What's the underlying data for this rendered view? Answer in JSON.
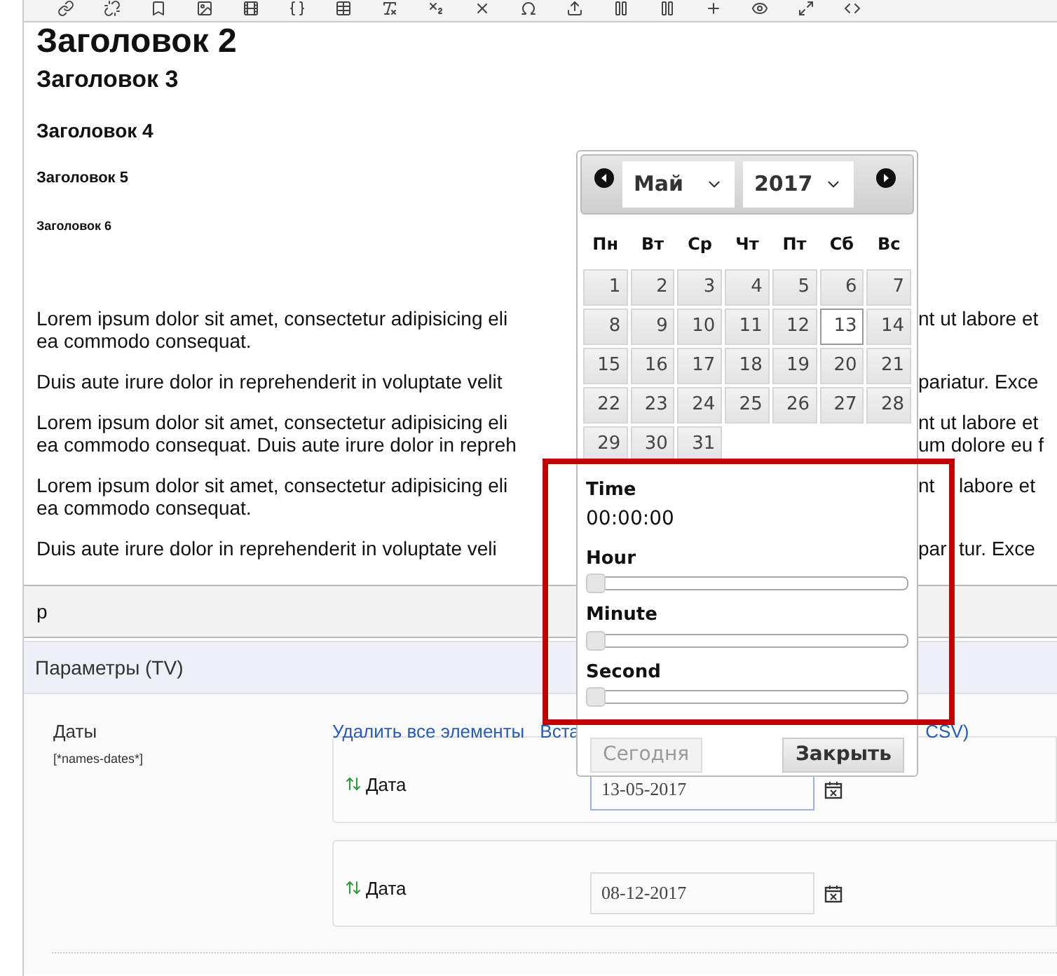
{
  "headings": [
    {
      "kind": "h2",
      "text": "Заголовок 2"
    },
    {
      "kind": "h3",
      "text": "Заголовок 3"
    },
    {
      "kind": "h4",
      "text": "Заголовок 4"
    },
    {
      "kind": "h5",
      "text": "Заголовок 5"
    },
    {
      "kind": "h6",
      "text": "Заголовок 6"
    }
  ],
  "paragraphs": [
    {
      "lines": [
        {
          "left": "Lorem ipsum dolor sit amet, consectetur adipisicing eli",
          "right": [
            "nt ut labore et"
          ]
        },
        {
          "left": "ea commodo consequat."
        }
      ]
    },
    {
      "lines": [
        {
          "left": "Duis aute irure dolor in reprehenderit in voluptate velit",
          "right": [
            "pariatur. Exce"
          ]
        }
      ]
    },
    {
      "lines": [
        {
          "left": "Lorem ipsum dolor sit amet, consectetur adipisicing eli",
          "right": [
            "nt ut labore et"
          ]
        },
        {
          "left": "ea commodo consequat. Duis aute irure dolor in repreh",
          "right": [
            "um dolore eu f"
          ]
        }
      ]
    },
    {
      "lines": [
        {
          "left": "Lorem ipsum dolor sit amet, consectetur adipisicing eli",
          "right": [
            "nt",
            "labore et"
          ]
        },
        {
          "left": "ea commodo consequat."
        }
      ]
    },
    {
      "lines": [
        {
          "left": "Duis aute irure dolor in reprehenderit in voluptate veli",
          "right": [
            "par",
            "tur. Exce"
          ]
        }
      ]
    }
  ],
  "element_path": "p",
  "panel": {
    "title": "Параметры (TV)",
    "field_label": "Даты",
    "field_tag": "[*names-dates*]",
    "links": [
      "Удалить все элементы",
      "Вста",
      "CSV)"
    ],
    "items": [
      {
        "label": "Дата",
        "value": "13-05-2017",
        "focused": true
      },
      {
        "label": "Дата",
        "value": "08-12-2017",
        "focused": false
      }
    ]
  },
  "datepicker": {
    "month": "Май",
    "year": "2017",
    "weekdays": [
      "Пн",
      "Вт",
      "Ср",
      "Чт",
      "Пт",
      "Сб",
      "Вс"
    ],
    "days": [
      {
        "day": "1",
        "selected": false
      },
      {
        "day": "2",
        "selected": false
      },
      {
        "day": "3",
        "selected": false
      },
      {
        "day": "4",
        "selected": false
      },
      {
        "day": "5",
        "selected": false
      },
      {
        "day": "6",
        "selected": false
      },
      {
        "day": "7",
        "selected": false
      },
      {
        "day": "8",
        "selected": false
      },
      {
        "day": "9",
        "selected": false
      },
      {
        "day": "10",
        "selected": false
      },
      {
        "day": "11",
        "selected": false
      },
      {
        "day": "12",
        "selected": false
      },
      {
        "day": "13",
        "selected": true
      },
      {
        "day": "14",
        "selected": false
      },
      {
        "day": "15",
        "selected": false
      },
      {
        "day": "16",
        "selected": false
      },
      {
        "day": "17",
        "selected": false
      },
      {
        "day": "18",
        "selected": false
      },
      {
        "day": "19",
        "selected": false
      },
      {
        "day": "20",
        "selected": false
      },
      {
        "day": "21",
        "selected": false
      },
      {
        "day": "22",
        "selected": false
      },
      {
        "day": "23",
        "selected": false
      },
      {
        "day": "24",
        "selected": false
      },
      {
        "day": "25",
        "selected": false
      },
      {
        "day": "26",
        "selected": false
      },
      {
        "day": "27",
        "selected": false
      },
      {
        "day": "28",
        "selected": false
      },
      {
        "day": "29",
        "selected": false
      },
      {
        "day": "30",
        "selected": false
      },
      {
        "day": "31",
        "selected": false
      }
    ],
    "time_label": "Time",
    "time_value": "00:00:00",
    "sliders": [
      {
        "label": "Hour",
        "level": 0
      },
      {
        "label": "Minute",
        "level": 0
      },
      {
        "label": "Second",
        "level": 0
      }
    ],
    "buttons": [
      {
        "label": "Сегодня",
        "disabled": true
      },
      {
        "label": "Закрыть",
        "disabled": false
      }
    ]
  }
}
